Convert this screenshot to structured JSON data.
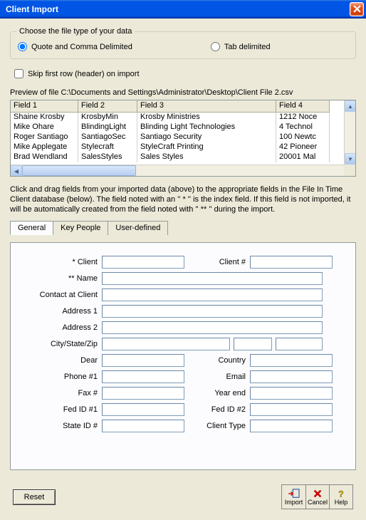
{
  "title": "Client Import",
  "group": {
    "legend": "Choose the file type of your data",
    "radio1": "Quote and Comma Delimited",
    "radio2": "Tab delimited"
  },
  "skip_label": "Skip first row (header) on import",
  "preview_label": "Preview of file C:\\Documents and Settings\\Administrator\\Desktop\\Client File 2.csv",
  "columns": {
    "c1": "Field 1",
    "c2": "Field 2",
    "c3": "Field 3",
    "c4": "Field 4"
  },
  "rows": [
    {
      "c1": "Shaine Krosby",
      "c2": "KrosbyMin",
      "c3": "Krosby Ministries",
      "c4": "1212 Noce"
    },
    {
      "c1": "Mike Ohare",
      "c2": "BlindingLight",
      "c3": "Blinding Light Technologies",
      "c4": "4 Technol"
    },
    {
      "c1": "Roger Santiago",
      "c2": "SantiagoSec",
      "c3": "Santiago Security",
      "c4": "100 Newtc"
    },
    {
      "c1": "Mike Applegate",
      "c2": "Stylecraft",
      "c3": "StyleCraft Printing",
      "c4": "42 Pioneer"
    },
    {
      "c1": "Brad Wendland",
      "c2": "SalesStyles",
      "c3": "Sales Styles",
      "c4": "20001 Mal"
    }
  ],
  "instructions": "Click and drag fields from your imported data (above) to the appropriate fields in the File In Time Client database (below).  The field noted with an '' * '' is the index field.  If this field is not imported, it will be automatically created from the field noted with '' ** '' during the import.",
  "tabs": {
    "t1": "General",
    "t2": "Key People",
    "t3": "User-defined"
  },
  "form": {
    "client": "* Client",
    "client_no": "Client #",
    "name": "** Name",
    "contact": "Contact at Client",
    "addr1": "Address 1",
    "addr2": "Address 2",
    "csz": "City/State/Zip",
    "dear": "Dear",
    "country": "Country",
    "phone1": "Phone #1",
    "email": "Email",
    "fax": "Fax #",
    "yearend": "Year end",
    "fedid1": "Fed ID #1",
    "fedid2": "Fed ID #2",
    "stateid": "State ID #",
    "clienttype": "Client Type"
  },
  "buttons": {
    "reset": "Reset",
    "import": "Import",
    "cancel": "Cancel",
    "help": "Help"
  }
}
